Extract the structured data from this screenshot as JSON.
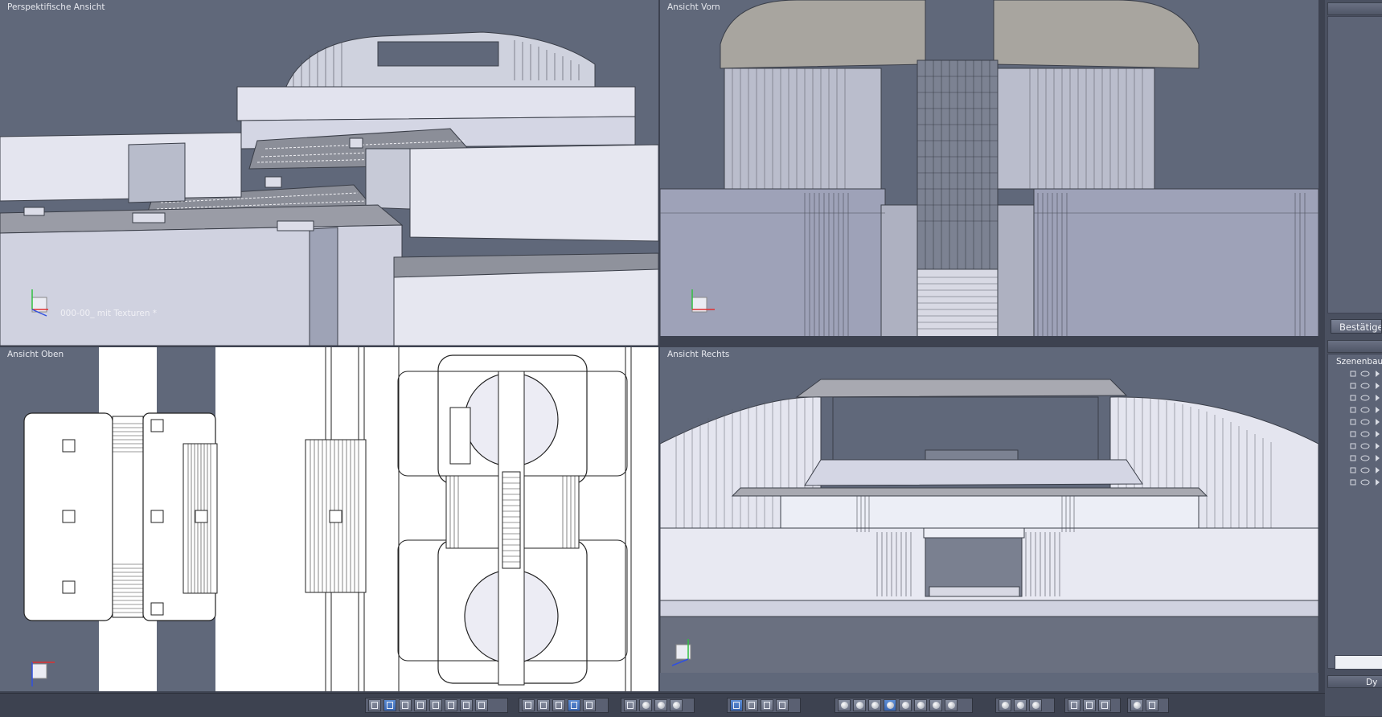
{
  "viewports": {
    "perspective": {
      "label": "Perspektifische Ansicht",
      "caption": "000-00_ mit Texturen *"
    },
    "front": {
      "label": "Ansicht Vorn"
    },
    "top": {
      "label": "Ansicht Oben"
    },
    "right": {
      "label": "Ansicht Rechts"
    }
  },
  "axes": {
    "x": "X",
    "y": "Y",
    "z": "Z"
  },
  "side_panel": {
    "confirm_button": "Bestätigen",
    "scene_title": "Szenenbau",
    "dy_label": "Dy"
  },
  "toolbar": {
    "groups": [
      {
        "name": "layout-buttons",
        "icons": [
          "layout-single-icon",
          "layout-quad-icon",
          "layout-split-h-icon",
          "layout-split-v-icon",
          "layout-three-icon",
          "layout-three-b-icon",
          "layout-stack-icon",
          "layout-columns-icon"
        ]
      },
      {
        "name": "render-buttons",
        "icons": [
          "texture-icon",
          "brush-icon",
          "grid-icon",
          "grid-blue-icon",
          "grid-green-icon"
        ]
      },
      {
        "name": "view-buttons",
        "icons": [
          "fit-icon",
          "orbit-icon",
          "zoom-icon",
          "eye-icon"
        ]
      },
      {
        "name": "tool-buttons",
        "icons": [
          "select-tool-icon",
          "cut-tool-icon",
          "wrench-tool-icon",
          "axe-tool-icon"
        ]
      },
      {
        "name": "shading-buttons",
        "icons": [
          "wire-sphere-icon",
          "wire-sphere-2-icon",
          "shaded-sphere-icon",
          "shaded-sphere-2-icon",
          "smooth-sphere-icon",
          "gray-sphere-icon",
          "dark-sphere-icon",
          "white-sphere-icon"
        ]
      },
      {
        "name": "light-buttons",
        "icons": [
          "lamp-icon",
          "lamp-2-icon",
          "lamp-group-icon"
        ]
      },
      {
        "name": "object-buttons",
        "icons": [
          "cube-icon",
          "cube-2-icon",
          "pillar-icon"
        ]
      },
      {
        "name": "camera-buttons",
        "icons": [
          "light-burst-icon",
          "camera-icon"
        ]
      }
    ]
  },
  "colors": {
    "viewport_bg": "#60687a",
    "geometry_light": "#d9dbe8",
    "geometry_line": "#3a3e48",
    "top_view_bg": "#ffffff"
  }
}
